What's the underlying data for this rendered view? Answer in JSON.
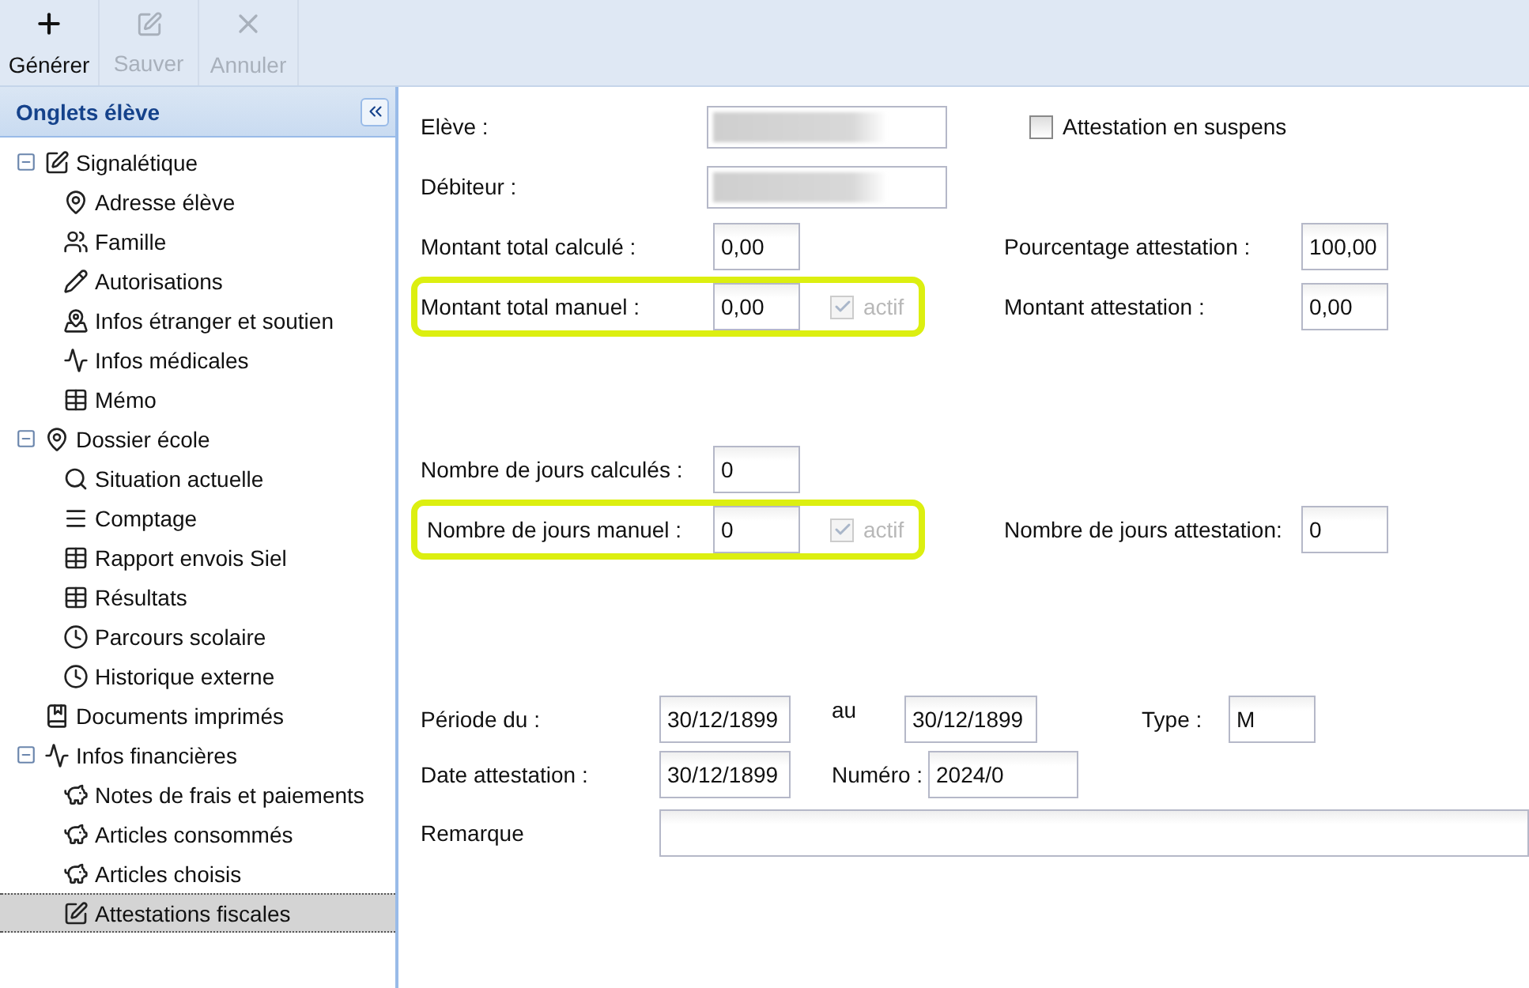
{
  "toolbar": [
    {
      "label": "Générer",
      "disabled": false
    },
    {
      "label": "Sauver",
      "disabled": true
    },
    {
      "label": "Annuler",
      "disabled": true
    }
  ],
  "sidebar": {
    "title": "Onglets élève",
    "items": [
      {
        "label": "Signalétique",
        "expanded": true,
        "selected": false,
        "children": [
          {
            "label": "Adresse élève",
            "selected": false
          },
          {
            "label": "Famille",
            "selected": false
          },
          {
            "label": "Autorisations",
            "selected": false
          },
          {
            "label": "Infos étranger et soutien",
            "selected": false
          },
          {
            "label": "Infos médicales",
            "selected": false
          },
          {
            "label": "Mémo",
            "selected": false
          }
        ]
      },
      {
        "label": "Dossier école",
        "expanded": true,
        "selected": false,
        "children": [
          {
            "label": "Situation actuelle",
            "selected": false
          },
          {
            "label": "Comptage",
            "selected": false
          },
          {
            "label": "Rapport envois Siel",
            "selected": false
          },
          {
            "label": "Résultats",
            "selected": false
          },
          {
            "label": "Parcours scolaire",
            "selected": false
          },
          {
            "label": "Historique externe",
            "selected": false
          }
        ]
      },
      {
        "label": "Documents imprimés",
        "selected": false
      },
      {
        "label": "Infos financières",
        "expanded": true,
        "selected": false,
        "children": [
          {
            "label": "Notes de frais et paiements",
            "selected": false
          },
          {
            "label": "Articles consommés",
            "selected": false
          },
          {
            "label": "Articles choisis",
            "selected": false
          },
          {
            "label": "Attestations fiscales",
            "selected": true
          }
        ]
      }
    ]
  },
  "form": {
    "people": [
      {
        "label": "Elève :"
      },
      {
        "label": "Débiteur :"
      }
    ],
    "suspended": {
      "label": "Attestation en suspens",
      "checked": false
    },
    "groups": [
      [
        {
          "label": "Montant total calculé :",
          "value": "0,00",
          "highlighted": false,
          "right": {
            "label": "Pourcentage attestation :",
            "value": "100,00"
          }
        },
        {
          "label": "Montant total manuel :",
          "value": "0,00",
          "highlighted": true,
          "active": {
            "label": "actif",
            "checked": true,
            "disabled": true
          },
          "right": {
            "label": "Montant attestation :",
            "value": "0,00"
          }
        }
      ],
      [
        {
          "label": "Nombre de jours calculés :",
          "value": "0",
          "highlighted": false
        },
        {
          "label": "Nombre de jours manuel :",
          "value": "0",
          "highlighted": true,
          "active": {
            "label": "actif",
            "checked": true,
            "disabled": true
          },
          "right": {
            "label": "Nombre de jours attestation:",
            "value": "0"
          }
        }
      ]
    ],
    "period": {
      "label": "Période du :",
      "from": "30/12/1899",
      "to_label": "au",
      "to": "30/12/1899",
      "type_label": "Type :",
      "type": "M"
    },
    "certificate": {
      "label": "Date attestation :",
      "date": "30/12/1899",
      "number_label": "Numéro :",
      "number": "2024/0"
    },
    "remark": {
      "label": "Remarque"
    }
  }
}
